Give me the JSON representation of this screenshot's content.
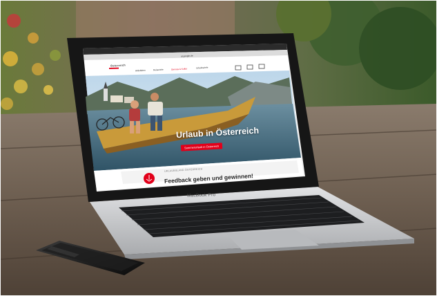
{
  "scene": {
    "description_colors": {
      "table_wood": "#6b5a4a",
      "laptop_body": "#c9cacc",
      "screen_bezel": "#1a1a1a",
      "accent_red": "#e2001a"
    }
  },
  "screen": {
    "browser_url": "at.google.de",
    "logo_text": "Österreich",
    "nav": [
      "Aktivitäten",
      "Reiseziele",
      "Genuss & Kultur",
      "Urlaubsziele"
    ],
    "active_nav_index": 2,
    "hero_title": "Urlaub in Österreich",
    "hero_button": "Sommerurlaub in Österreich",
    "feedback_overline": "URLAUBSLAND ÖSTERREICH",
    "feedback_title": "Feedback geben und gewinnen!"
  },
  "laptop": {
    "brand_label": "MacBook Pro"
  }
}
